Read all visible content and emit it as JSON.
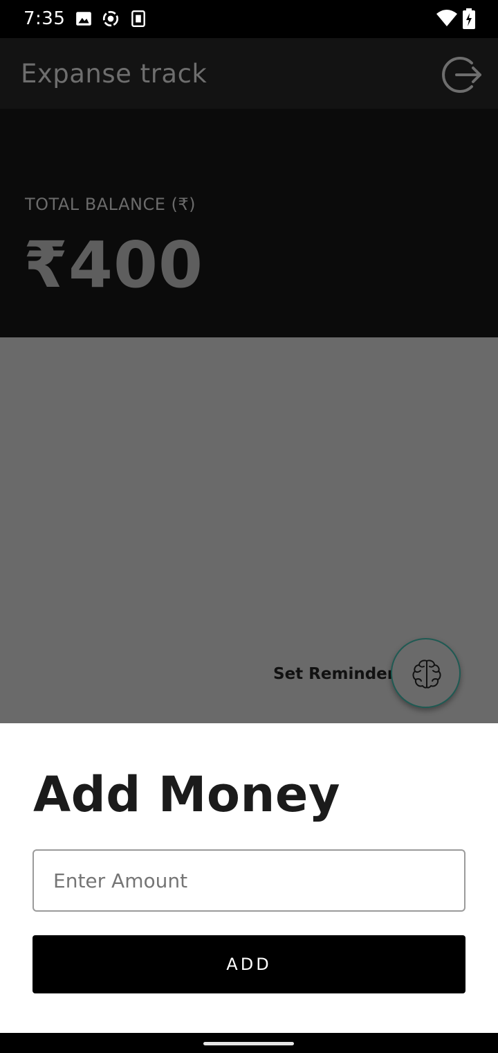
{
  "status_bar": {
    "time": "7:35",
    "left_icons": [
      "image-icon",
      "screen-record-icon",
      "sim-card-icon"
    ],
    "right_icons": [
      "wifi-icon",
      "battery-charging-icon"
    ]
  },
  "app_bar": {
    "title": "Expanse track",
    "logout_icon": "logout-icon"
  },
  "balance": {
    "label": "TOTAL BALANCE (₹)",
    "amount": "₹400"
  },
  "reminder": {
    "label": "Set Reminder",
    "icon": "brain-icon"
  },
  "sheet": {
    "title": "Add Money",
    "amount_placeholder": "Enter Amount",
    "amount_value": "",
    "add_label": "ADD"
  },
  "colors": {
    "scrim": "#6a6a6a",
    "fab_border": "#1f5a53",
    "button": "#000000"
  }
}
